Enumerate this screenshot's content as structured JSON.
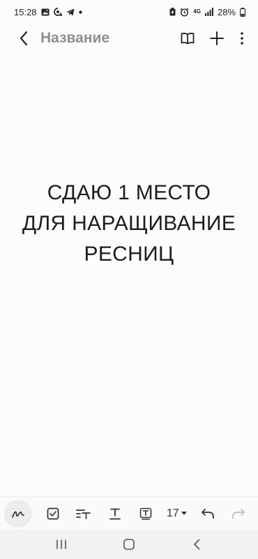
{
  "status_bar": {
    "time": "15:28",
    "network": "4G",
    "battery": "28%"
  },
  "app_bar": {
    "title": "Название"
  },
  "note": {
    "lines": [
      "СДАЮ 1 МЕСТО",
      "ДЛЯ НАРАЩИВАНИЕ",
      "РЕСНИЦ"
    ]
  },
  "toolbar": {
    "font_size": "17"
  },
  "icons": {
    "status_left": [
      "gallery-icon",
      "messenger-icon",
      "telegram-icon",
      "dot-icon"
    ],
    "status_right": [
      "battery-saver-icon",
      "alarm-icon",
      "signal-icon",
      "battery-icon"
    ],
    "app_bar": [
      "back-icon",
      "book-icon",
      "add-icon",
      "more-vert-icon"
    ],
    "toolbar": [
      "pen-icon",
      "checkbox-icon",
      "text-style-icon",
      "text-underline-icon",
      "text-box-icon",
      "undo-icon",
      "redo-icon"
    ],
    "nav": [
      "recents-icon",
      "home-icon",
      "back-nav-icon"
    ]
  }
}
